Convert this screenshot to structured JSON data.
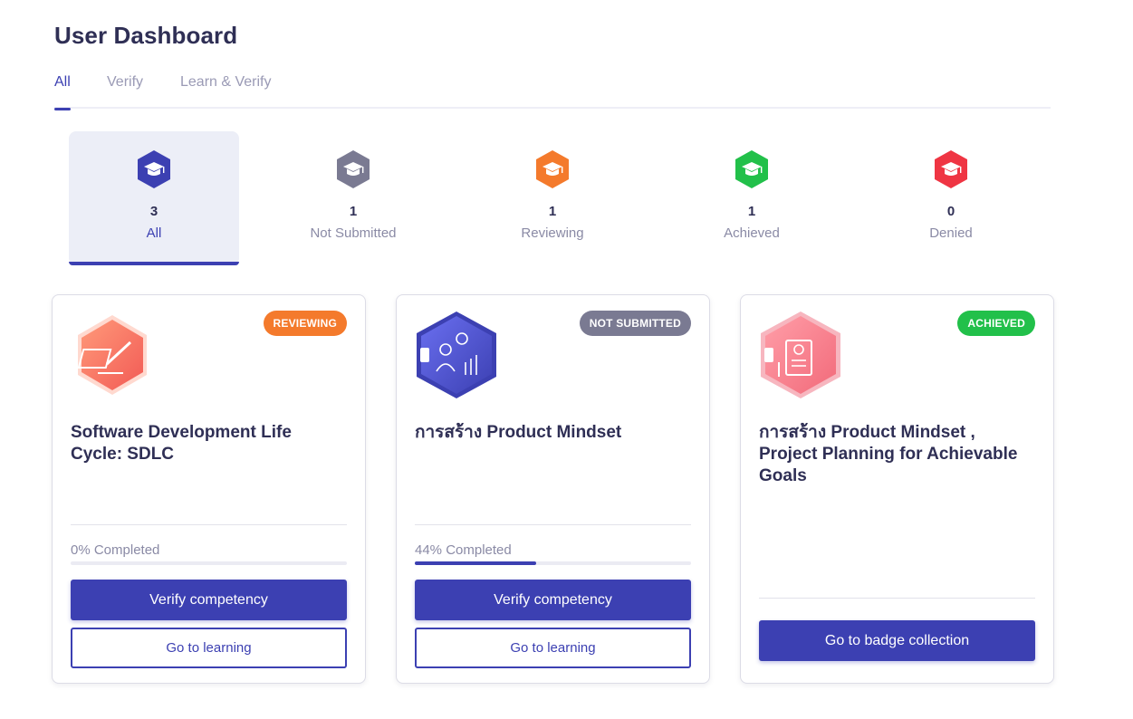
{
  "page": {
    "title": "User Dashboard"
  },
  "tabs": [
    {
      "label": "All",
      "active": true
    },
    {
      "label": "Verify",
      "active": false
    },
    {
      "label": "Learn & Verify",
      "active": false
    }
  ],
  "stats": [
    {
      "count": "3",
      "label": "All",
      "color": "#3c40b2",
      "icon": "graduation-cap-icon",
      "active": true
    },
    {
      "count": "1",
      "label": "Not Submitted",
      "color": "#7a7a92",
      "icon": "graduation-cap-icon",
      "active": false
    },
    {
      "count": "1",
      "label": "Reviewing",
      "color": "#f47a2c",
      "icon": "graduation-cap-icon",
      "active": false
    },
    {
      "count": "1",
      "label": "Achieved",
      "color": "#22c04a",
      "icon": "graduation-cap-icon",
      "active": false
    },
    {
      "count": "0",
      "label": "Denied",
      "color": "#ef3543",
      "icon": "graduation-cap-icon",
      "active": false
    }
  ],
  "cards": [
    {
      "status": "REVIEWING",
      "status_color": "#f47a2c",
      "icon": "pencil-writing-badge-icon",
      "title": "Software Development Life Cycle: SDLC",
      "progress_label": "0% Completed",
      "progress": 0,
      "primary_button": "Verify competency",
      "secondary_button": "Go to learning"
    },
    {
      "status": "NOT SUBMITTED",
      "status_color": "#7a7a92",
      "icon": "mindset-lightbulb-badge-icon",
      "title": "การสร้าง Product Mindset",
      "progress_label": "44% Completed",
      "progress": 0.44,
      "primary_button": "Verify competency",
      "secondary_button": "Go to learning"
    },
    {
      "status": "ACHIEVED",
      "status_color": "#22c04a",
      "icon": "project-planning-badge-icon",
      "title": "การสร้าง Product Mindset , Project Planning for Achievable Goals",
      "primary_button": "Go to badge collection"
    }
  ]
}
